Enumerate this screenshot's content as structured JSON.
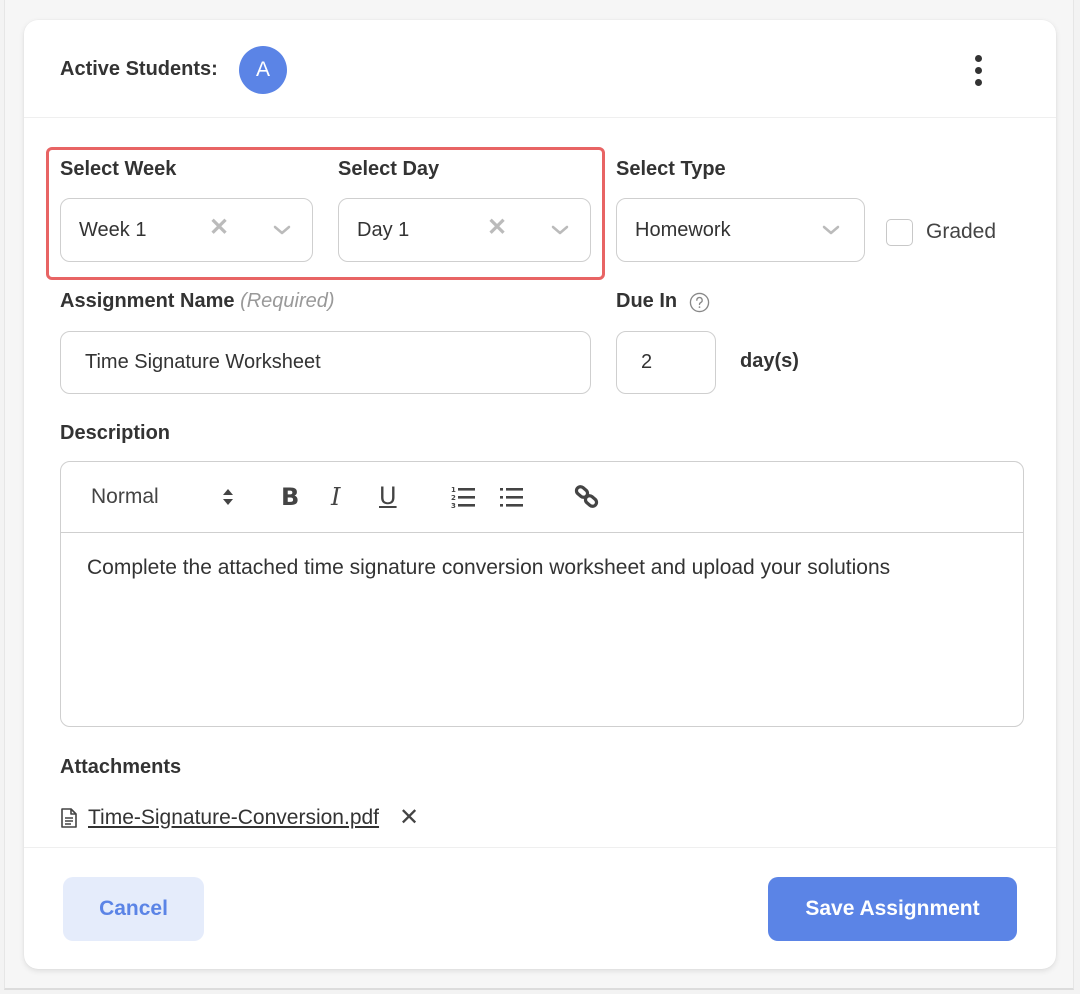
{
  "header": {
    "active_students_label": "Active Students:",
    "avatar_initial": "A",
    "more_menu_icon": "kebab-vertical-icon"
  },
  "form": {
    "week": {
      "label": "Select Week",
      "value": "Week 1",
      "clear_icon": "close-icon",
      "dropdown_icon": "chevron-down-icon"
    },
    "day": {
      "label": "Select Day",
      "value": "Day 1",
      "clear_icon": "close-icon",
      "dropdown_icon": "chevron-down-icon"
    },
    "type": {
      "label": "Select Type",
      "value": "Homework",
      "dropdown_icon": "chevron-down-icon"
    },
    "graded": {
      "label": "Graded",
      "checked": false
    },
    "assignment_name": {
      "label": "Assignment Name",
      "required_hint": "(Required)",
      "value": "Time Signature Worksheet"
    },
    "due_in": {
      "label": "Due In",
      "help_icon": "question-circle-icon",
      "value": "2",
      "unit": "day(s)"
    },
    "description": {
      "label": "Description",
      "toolbar": {
        "format_select": "Normal",
        "bold": "B",
        "italic": "I",
        "underline": "U",
        "ordered_list_icon": "ordered-list-icon",
        "bullet_list_icon": "bullet-list-icon",
        "link_icon": "link-icon"
      },
      "body": "Complete the attached time signature conversion worksheet and upload your solutions"
    },
    "attachments": {
      "label": "Attachments",
      "files": [
        {
          "name": "Time-Signature-Conversion.pdf",
          "icon": "file-document-icon",
          "remove_icon": "close-icon"
        }
      ]
    }
  },
  "actions": {
    "cancel_label": "Cancel",
    "save_label": "Save Assignment"
  },
  "colors": {
    "accent": "#5b84e6",
    "accent_light": "#e5ecfb",
    "highlight": "#e86464"
  }
}
